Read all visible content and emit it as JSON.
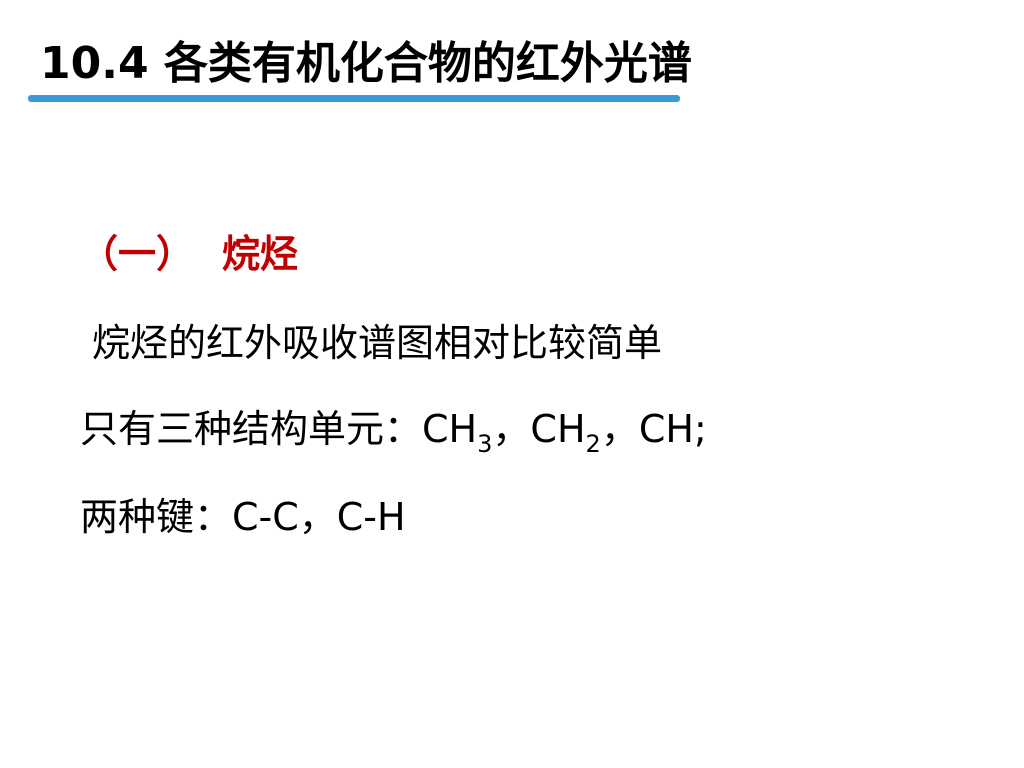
{
  "slide": {
    "title": "10.4 各类有机化合物的红外光谱",
    "section": {
      "number": "（一）",
      "name": "烷烃"
    },
    "lines": {
      "line1": "烷烃的红外吸收谱图相对比较简单",
      "line2": {
        "prefix": "只有三种结构单元：",
        "unit1": "CH",
        "unit1_sub": "3",
        "sep1": "，",
        "unit2": "CH",
        "unit2_sub": "2",
        "sep2": "，",
        "unit3": "CH",
        "end": ";"
      },
      "line3": "两种键：C-C，C-H"
    }
  },
  "colors": {
    "background": "#ffffff",
    "text": "#000000",
    "accent_red": "#c00000",
    "underline_blue": "#3a9ad9"
  }
}
